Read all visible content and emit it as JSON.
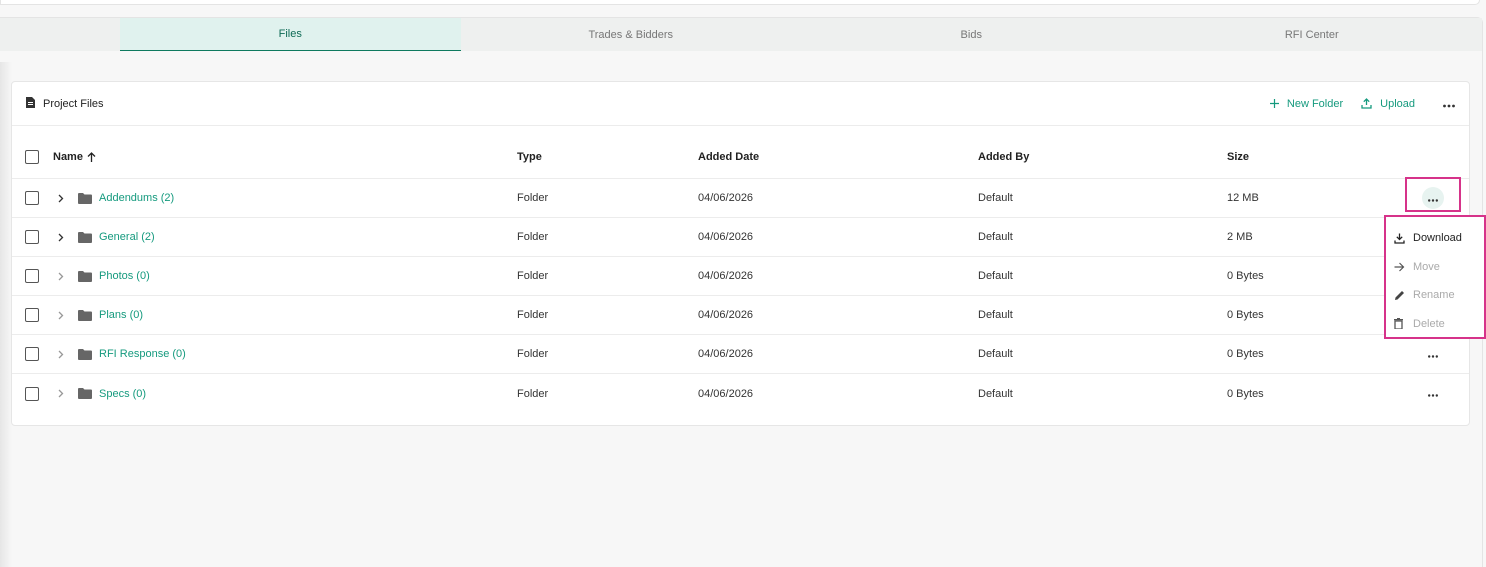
{
  "tabs": [
    {
      "label": "Files",
      "active": true
    },
    {
      "label": "Trades & Bidders",
      "active": false
    },
    {
      "label": "Bids",
      "active": false
    },
    {
      "label": "RFI Center",
      "active": false
    }
  ],
  "card": {
    "title": "Project Files",
    "title_icon": "document-icon",
    "new_folder_label": "New Folder",
    "upload_label": "Upload"
  },
  "table": {
    "columns": {
      "name": "Name",
      "type": "Type",
      "added_date": "Added Date",
      "added_by": "Added By",
      "size": "Size"
    },
    "sort": {
      "column": "Name",
      "direction": "ascending"
    },
    "rows": [
      {
        "name": "Addendums (2)",
        "type": "Folder",
        "added_date": "04/06/2026",
        "added_by": "Default",
        "size": "12 MB"
      },
      {
        "name": "General (2)",
        "type": "Folder",
        "added_date": "04/06/2026",
        "added_by": "Default",
        "size": "2 MB"
      },
      {
        "name": "Photos (0)",
        "type": "Folder",
        "added_date": "04/06/2026",
        "added_by": "Default",
        "size": "0 Bytes"
      },
      {
        "name": "Plans (0)",
        "type": "Folder",
        "added_date": "04/06/2026",
        "added_by": "Default",
        "size": "0 Bytes"
      },
      {
        "name": "RFI Response (0)",
        "type": "Folder",
        "added_date": "04/06/2026",
        "added_by": "Default",
        "size": "0 Bytes"
      },
      {
        "name": "Specs (0)",
        "type": "Folder",
        "added_date": "04/06/2026",
        "added_by": "Default",
        "size": "0 Bytes"
      }
    ]
  },
  "context_menu": {
    "items": [
      {
        "label": "Download",
        "icon": "download-icon",
        "enabled": true
      },
      {
        "label": "Move",
        "icon": "arrow-right-icon",
        "enabled": false
      },
      {
        "label": "Rename",
        "icon": "pencil-icon",
        "enabled": false
      },
      {
        "label": "Delete",
        "icon": "trash-icon",
        "enabled": false
      }
    ]
  },
  "colors": {
    "accent": "#159a7e",
    "highlight": "#d6338a",
    "active_tab_bg": "#e0f2ee"
  }
}
